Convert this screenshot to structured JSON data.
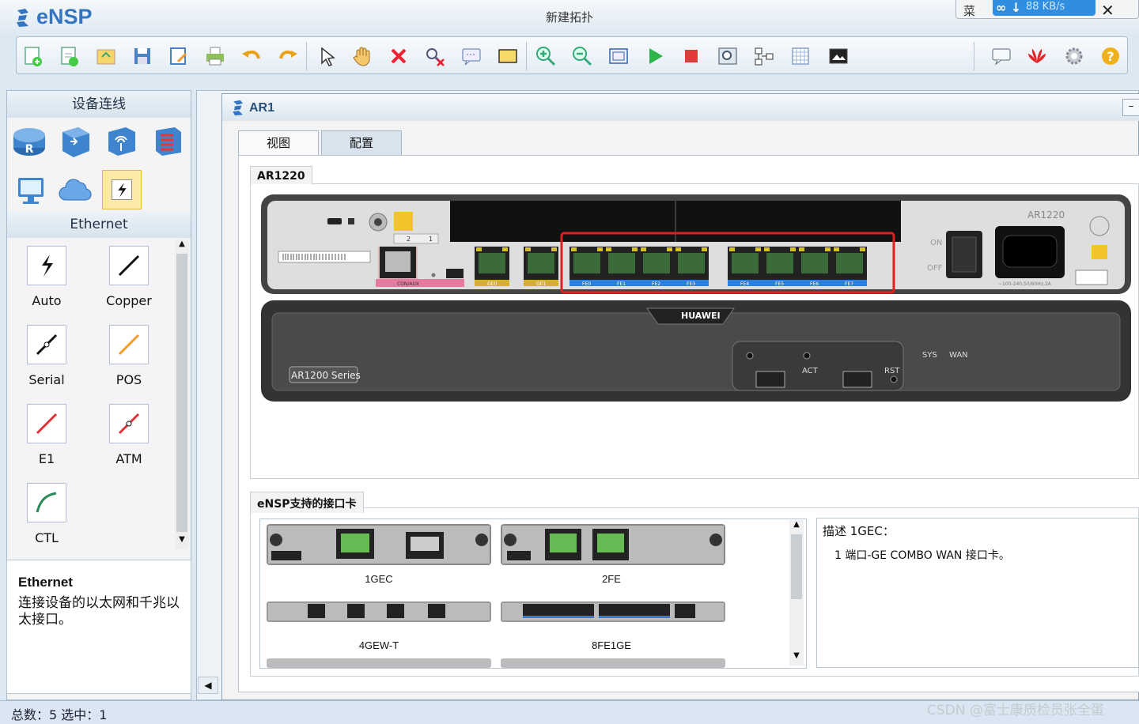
{
  "app": {
    "name": "eNSP",
    "window_title": "新建拓扑",
    "menu_label": "菜",
    "net_speed": "88 KB/s",
    "close_glyph": "✕"
  },
  "toolbar": {
    "buttons": [
      "new-topology",
      "new-lab",
      "open",
      "save",
      "save-as",
      "print",
      "undo",
      "redo",
      "select",
      "pan",
      "delete",
      "delete-link",
      "text-note",
      "rectangle",
      "zoom-in",
      "zoom-out",
      "fit",
      "start",
      "stop",
      "capture",
      "topology",
      "grid",
      "screenshot",
      "chat",
      "huawei",
      "settings",
      "help"
    ]
  },
  "left_panel": {
    "section_title": "设备连线",
    "device_icons": [
      "router-icon",
      "switch-icon",
      "wireless-icon",
      "firewall-icon",
      "pc-icon",
      "cloud-icon",
      "cable-icon"
    ],
    "cable_section_title": "Ethernet",
    "cables": [
      {
        "label": "Auto",
        "color": "#111111"
      },
      {
        "label": "Copper",
        "color": "#111111"
      },
      {
        "label": "Serial",
        "color": "#111111"
      },
      {
        "label": "POS",
        "color": "#f39a2a"
      },
      {
        "label": "E1",
        "color": "#e03232"
      },
      {
        "label": "ATM",
        "color": "#e03232"
      },
      {
        "label": "CTL",
        "color": "#2a8a5a"
      }
    ]
  },
  "description": {
    "title": "Ethernet",
    "text": "连接设备的以太网和千兆以太接口。"
  },
  "dialog": {
    "title": "AR1",
    "tabs": [
      {
        "label": "视图"
      },
      {
        "label": "配置"
      }
    ],
    "device_group": "AR1220",
    "router": {
      "model_label": "AR1220",
      "series_label": "AR1200 Series",
      "brand": "HUAWEI",
      "ports_ge": [
        "GE0",
        "GE1"
      ],
      "ports_fe": [
        "FE0",
        "FE1",
        "FE2",
        "FE3",
        "FE4",
        "FE5",
        "FE6",
        "FE7"
      ],
      "console_label": "CON/AUX",
      "power_on": "ON",
      "power_off": "OFF",
      "power_spec": "~100-240,50/60Hz,2A",
      "labels": {
        "sys": "SYS",
        "wan": "WAN",
        "act": "ACT",
        "rst": "RST"
      },
      "slot_numbers": [
        "2",
        "1"
      ]
    },
    "cards_group": "eNSP支持的接口卡",
    "cards": [
      {
        "name": "1GEC"
      },
      {
        "name": "2FE"
      },
      {
        "name": "4GEW-T"
      },
      {
        "name": "8FE1GE"
      }
    ],
    "card_description": {
      "title": "描述 1GEC：",
      "text": "1 端口-GE COMBO WAN 接口卡。"
    }
  },
  "status_bar": {
    "text": "总数：5  选中：1"
  },
  "watermark": "CSDN @富士康质检员张全蛋",
  "colors": {
    "accent": "#3575c0",
    "highlight": "#e02020",
    "port_blue": "#2a7fe0",
    "port_yellow": "#d6b02a"
  }
}
